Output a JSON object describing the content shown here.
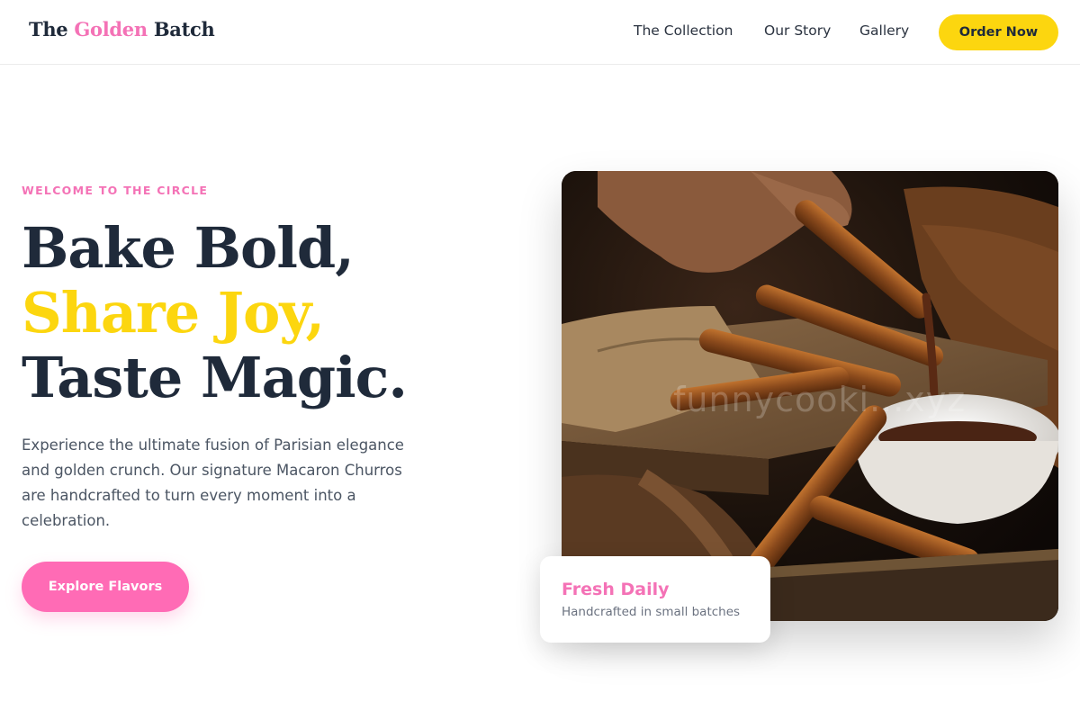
{
  "header": {
    "logo": {
      "part1": "The ",
      "accent": "Golden",
      "part2": " Batch"
    },
    "nav": [
      {
        "label": "The Collection"
      },
      {
        "label": "Our Story"
      },
      {
        "label": "Gallery"
      }
    ],
    "cta_label": "Order Now"
  },
  "hero": {
    "eyebrow": "WELCOME TO THE CIRCLE",
    "headline": {
      "line1": "Bake Bold,",
      "line2": "Share Joy,",
      "line3": "Taste Magic."
    },
    "description": "Experience the ultimate fusion of Parisian elegance and golden crunch. Our signature Macaron Churros are handcrafted to turn every moment into a celebration.",
    "cta_label": "Explore Flavors",
    "image": {
      "watermark": "funnycooki...xyz"
    },
    "badge": {
      "title": "Fresh Daily",
      "subtitle": "Handcrafted in small batches"
    }
  },
  "colors": {
    "primary_text": "#1f2a3a",
    "accent_pink": "#f472b6",
    "accent_yellow": "#fcd60f",
    "button_pink": "#ff6bb5",
    "body_text": "#4b5563"
  },
  "icons": []
}
